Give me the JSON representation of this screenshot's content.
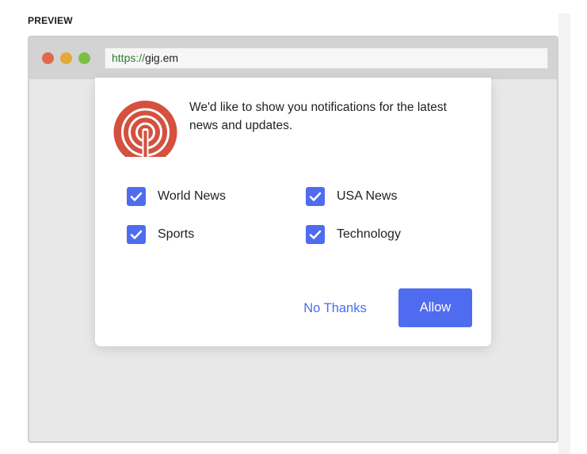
{
  "preview": {
    "label": "PREVIEW"
  },
  "browser": {
    "url_scheme": "https://",
    "url_host": "gig.em"
  },
  "prompt": {
    "message": "We'd like to show you notifications for the latest news and updates.",
    "logo_icon": "onesignal-bell-icon",
    "categories": [
      {
        "label": "World News",
        "checked": true
      },
      {
        "label": "USA News",
        "checked": true
      },
      {
        "label": "Sports",
        "checked": true
      },
      {
        "label": "Technology",
        "checked": true
      }
    ],
    "no_thanks_label": "No Thanks",
    "allow_label": "Allow"
  },
  "colors": {
    "accent": "#4f6cf0",
    "logo": "#d3513e",
    "dot_red": "#e0684b",
    "dot_yellow": "#e4a936",
    "dot_green": "#7ac045"
  }
}
